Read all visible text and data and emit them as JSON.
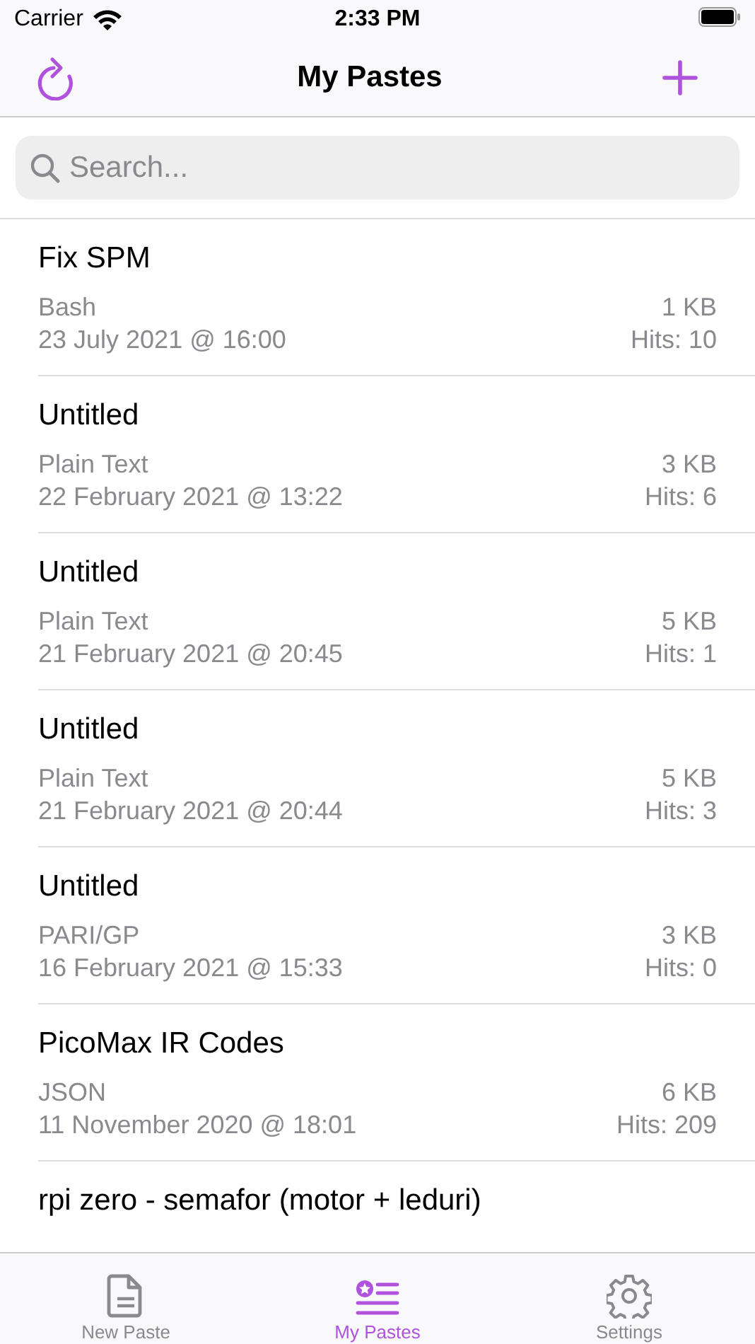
{
  "status_bar": {
    "carrier": "Carrier",
    "time": "2:33 PM"
  },
  "nav": {
    "title": "My Pastes"
  },
  "search": {
    "placeholder": "Search..."
  },
  "pastes": [
    {
      "title": "Fix SPM",
      "language": "Bash",
      "size": "1 KB",
      "date": "23 July 2021 @ 16:00",
      "hits": "Hits: 10"
    },
    {
      "title": "Untitled",
      "language": "Plain Text",
      "size": "3 KB",
      "date": "22 February 2021 @ 13:22",
      "hits": "Hits: 6"
    },
    {
      "title": "Untitled",
      "language": "Plain Text",
      "size": "5 KB",
      "date": "21 February 2021 @ 20:45",
      "hits": "Hits: 1"
    },
    {
      "title": "Untitled",
      "language": "Plain Text",
      "size": "5 KB",
      "date": "21 February 2021 @ 20:44",
      "hits": "Hits: 3"
    },
    {
      "title": "Untitled",
      "language": "PARI/GP",
      "size": "3 KB",
      "date": "16 February 2021 @ 15:33",
      "hits": "Hits: 0"
    },
    {
      "title": "PicoMax IR Codes",
      "language": "JSON",
      "size": "6 KB",
      "date": "11 November 2020 @ 18:01",
      "hits": "Hits: 209"
    },
    {
      "title": "rpi zero - semafor (motor + leduri)"
    }
  ],
  "tabs": [
    {
      "kind": "document",
      "label": "New Paste",
      "selected": false
    },
    {
      "kind": "list",
      "label": "My Pastes",
      "selected": true
    },
    {
      "kind": "gear",
      "label": "Settings",
      "selected": false
    }
  ]
}
